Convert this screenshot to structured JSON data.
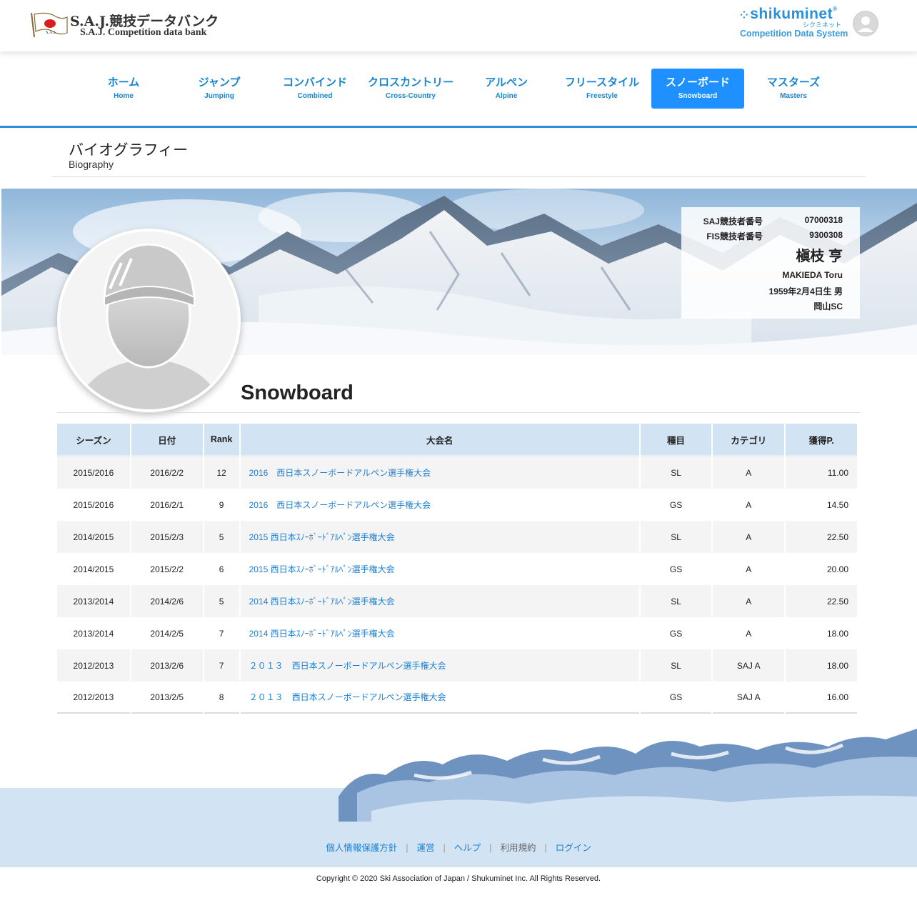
{
  "header": {
    "logo_jp": "S.A.J.競技データバンク",
    "logo_en": "S.A.J. Competition data bank",
    "flag_label": "S.A.J.",
    "partner_name": "shikuminet",
    "partner_kana": "シクミネット",
    "partner_sub": "Competition Data System"
  },
  "nav": {
    "items": [
      {
        "jp": "ホーム",
        "en": "Home"
      },
      {
        "jp": "ジャンプ",
        "en": "Jumping"
      },
      {
        "jp": "コンバインド",
        "en": "Combined"
      },
      {
        "jp": "クロスカントリー",
        "en": "Cross-Country"
      },
      {
        "jp": "アルペン",
        "en": "Alpine"
      },
      {
        "jp": "フリースタイル",
        "en": "Freestyle"
      },
      {
        "jp": "スノーボード",
        "en": "Snowboard"
      },
      {
        "jp": "マスターズ",
        "en": "Masters"
      }
    ],
    "active_index": 6
  },
  "page": {
    "title": "バイオグラフィー",
    "subtitle": "Biography"
  },
  "athlete": {
    "saj_label": "SAJ競技者番号",
    "saj_number": "07000318",
    "fis_label": "FIS競技者番号",
    "fis_number": "9300308",
    "name_jp": "槇枝 亨",
    "name_en": "MAKIEDA Toru",
    "birth_gender": "1959年2月4日生 男",
    "club": "岡山SC"
  },
  "sport": {
    "title": "Snowboard"
  },
  "table": {
    "headers": [
      "シーズン",
      "日付",
      "Rank",
      "大会名",
      "種目",
      "カテゴリ",
      "獲得P."
    ],
    "rows": [
      {
        "season": "2015/2016",
        "date": "2016/2/2",
        "rank": "12",
        "event": "2016　西日本スノーボードアルペン選手権大会",
        "discipline": "SL",
        "category": "A",
        "points": "11.00"
      },
      {
        "season": "2015/2016",
        "date": "2016/2/1",
        "rank": "9",
        "event": "2016　西日本スノーボードアルペン選手権大会",
        "discipline": "GS",
        "category": "A",
        "points": "14.50"
      },
      {
        "season": "2014/2015",
        "date": "2015/2/3",
        "rank": "5",
        "event": "2015 西日本ｽﾉｰﾎﾞｰﾄﾞｱﾙﾍﾟﾝ選手権大会",
        "discipline": "SL",
        "category": "A",
        "points": "22.50"
      },
      {
        "season": "2014/2015",
        "date": "2015/2/2",
        "rank": "6",
        "event": "2015 西日本ｽﾉｰﾎﾞｰﾄﾞｱﾙﾍﾟﾝ選手権大会",
        "discipline": "GS",
        "category": "A",
        "points": "20.00"
      },
      {
        "season": "2013/2014",
        "date": "2014/2/6",
        "rank": "5",
        "event": "2014 西日本ｽﾉｰﾎﾞｰﾄﾞｱﾙﾍﾟﾝ選手権大会",
        "discipline": "SL",
        "category": "A",
        "points": "22.50"
      },
      {
        "season": "2013/2014",
        "date": "2014/2/5",
        "rank": "7",
        "event": "2014 西日本ｽﾉｰﾎﾞｰﾄﾞｱﾙﾍﾟﾝ選手権大会",
        "discipline": "GS",
        "category": "A",
        "points": "18.00"
      },
      {
        "season": "2012/2013",
        "date": "2013/2/6",
        "rank": "7",
        "event": "２０１３　西日本スノーボードアルペン選手権大会",
        "discipline": "SL",
        "category": "SAJ A",
        "points": "18.00"
      },
      {
        "season": "2012/2013",
        "date": "2013/2/5",
        "rank": "8",
        "event": "２０１３　西日本スノーボードアルペン選手権大会",
        "discipline": "GS",
        "category": "SAJ A",
        "points": "16.00"
      }
    ]
  },
  "footer": {
    "links": {
      "privacy": "個人情報保護方針",
      "operator": "運営",
      "help": "ヘルプ",
      "terms": "利用規約",
      "login": "ログイン"
    },
    "separator": "|",
    "copyright": "Copyright © 2020 Ski Association of Japan / Shukuminet Inc. All Rights Reserved."
  },
  "icons": {
    "flag": "japan-flag-icon",
    "user": "user-avatar-icon",
    "athlete_photo": "athlete-placeholder-icon"
  },
  "colors": {
    "accent": "#1a85d0",
    "active_tab": "#1e90ff",
    "table_header": "#d2e4f4",
    "footer_band": "#d2e4f4"
  }
}
